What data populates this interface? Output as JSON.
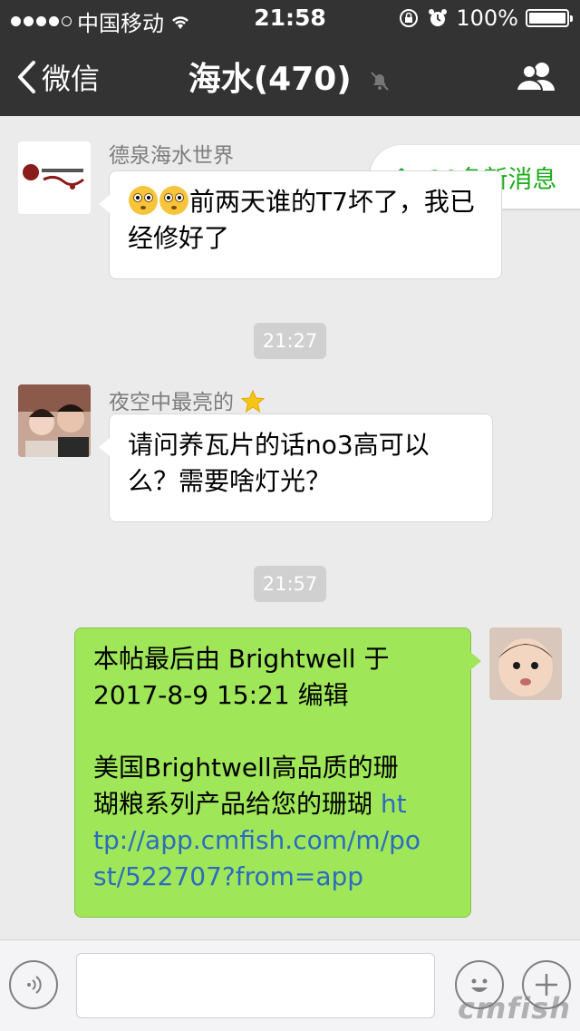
{
  "status_bar": {
    "carrier": "中国移动",
    "time": "21:58",
    "battery": "100%",
    "battery_level": 1.0,
    "signal_bars_filled": 4
  },
  "nav": {
    "back_label": "微信",
    "title": "海水(470)"
  },
  "new_messages": {
    "label": "20条新消息"
  },
  "messages": [
    {
      "sender": "德泉海水世界",
      "text": "前两天谁的T7坏了，我已经修好了"
    },
    {
      "timestamp": "21:27"
    },
    {
      "sender": "夜空中最亮的",
      "text": "请问养瓦片的话no3高可以么？需要啥灯光？"
    },
    {
      "timestamp": "21:57"
    },
    {
      "text_line1": "本帖最后由 Brightwell 于",
      "text_line2": "2017-8-9 15:21 编辑",
      "text_line3": "美国Brightwell高品质的珊",
      "text_line4": "瑚粮系列产品给您的珊瑚 ",
      "link_part1": "ht",
      "link_part2": "tp://app.cmfish.com/m/po",
      "link_part3": "st/522707?from=app"
    }
  ],
  "watermark": "cmfish",
  "colors": {
    "header_bg": "#333334",
    "chat_bg": "#ebebeb",
    "outgoing_bubble": "#9fe658",
    "accent_green": "#1aad19",
    "link": "#2c6cbf"
  }
}
